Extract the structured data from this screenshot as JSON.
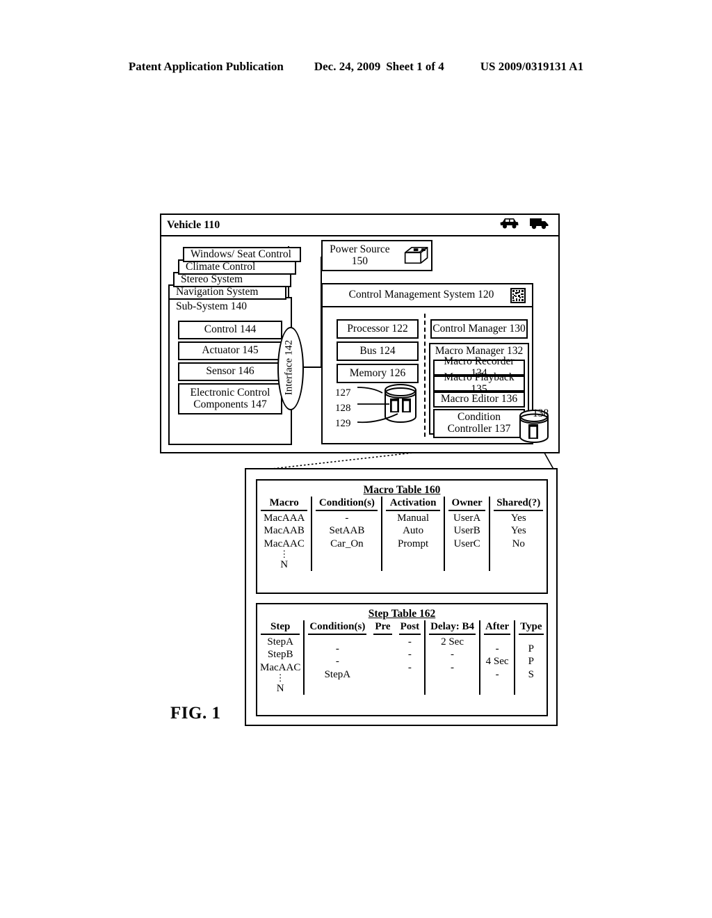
{
  "header": {
    "publication": "Patent Application Publication",
    "date": "Dec. 24, 2009",
    "sheet": "Sheet 1 of 4",
    "number": "US 2009/0319131 A1"
  },
  "figure_label": "FIG. 1",
  "vehicle": {
    "title": "Vehicle 110",
    "icons": [
      "car-icon",
      "truck-icon"
    ],
    "subsystem_stack": [
      "Windows/ Seat Control",
      "Climate Control",
      "Stereo System",
      "Navigation System"
    ],
    "subsystem": {
      "label": "Sub-System 140",
      "components": [
        "Control 144",
        "Actuator 145",
        "Sensor 146",
        "Electronic Control Components 147"
      ]
    },
    "interface": "Interface 142",
    "power_source": "Power Source 150",
    "power_source_icon": "battery-icon",
    "control_management_system": {
      "title": "Control Management System 120",
      "icon": "matrix-code-icon",
      "left_column": [
        "Processor 122",
        "Bus 124",
        "Memory 126"
      ],
      "memory_callouts": [
        "127",
        "128",
        "129"
      ],
      "memory_icon": "database-cylinder-icon",
      "right_column": {
        "control_manager": "Control Manager 130",
        "macro_manager": "Macro Manager 132",
        "macro_recorder": "Macro Recorder 134",
        "macro_playback": "Macro Playback 135",
        "macro_editor": "Macro Editor 136",
        "condition_controller": "Condition Controller 137"
      }
    },
    "database_138": {
      "label": "138",
      "icon": "database-cylinder-icon"
    }
  },
  "macro_table": {
    "title": "Macro Table 160",
    "columns": [
      "Macro",
      "Condition(s)",
      "Activation",
      "Owner",
      "Shared(?)"
    ],
    "rows": [
      [
        "MacAAA",
        "-",
        "Manual",
        "UserA",
        "Yes"
      ],
      [
        "MacAAB",
        "SetAAB",
        "Auto",
        "UserB",
        "Yes"
      ],
      [
        "MacAAC",
        "Car_On",
        "Prompt",
        "UserC",
        "No"
      ]
    ],
    "ellipsis": "⋮",
    "last_row": "N"
  },
  "step_table": {
    "title": "Step Table 162",
    "columns": [
      "Step",
      "Condition(s)",
      "Pre",
      "Post",
      "Delay: B4",
      "After",
      "Type"
    ],
    "step_names": [
      "StepA",
      "StepB",
      "MacAAC"
    ],
    "conditions": [
      "-",
      "-",
      "StepA"
    ],
    "pre": [
      "",
      "",
      ""
    ],
    "post": [
      "-",
      "-",
      "-"
    ],
    "delay_b4": [
      "2 Sec",
      "-",
      "-"
    ],
    "after": [
      "-",
      "4 Sec",
      "-"
    ],
    "type": [
      "P",
      "P",
      "S"
    ],
    "ellipsis": "⋮",
    "last_row": "N"
  }
}
